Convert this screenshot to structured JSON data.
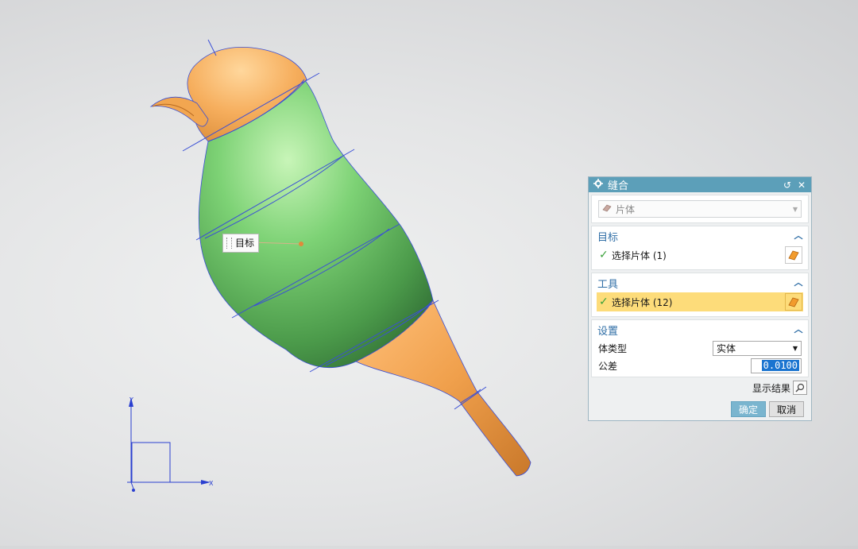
{
  "viewport": {
    "callout_label": "目标",
    "triad": {
      "x_label": "X",
      "y_label": "Y"
    }
  },
  "dialog": {
    "title": "缝合",
    "type_select": {
      "value": "片体",
      "icon": "sheet-body-icon"
    },
    "target": {
      "header": "目标",
      "pick_text": "选择片体 (1)"
    },
    "tool": {
      "header": "工具",
      "pick_text": "选择片体 (12)"
    },
    "settings": {
      "header": "设置",
      "body_type_label": "体类型",
      "body_type_value": "实体",
      "tolerance_label": "公差",
      "tolerance_value": "0.0100"
    },
    "show_result_label": "显示结果",
    "ok_label": "确定",
    "cancel_label": "取消"
  },
  "colors": {
    "title_bar": "#5c9fb9",
    "section_header": "#2f6ea6",
    "active_row": "#fddc7a",
    "body_green": "#6ec46a",
    "body_orange": "#f2a650",
    "edge_blue": "#3a4fd6"
  }
}
